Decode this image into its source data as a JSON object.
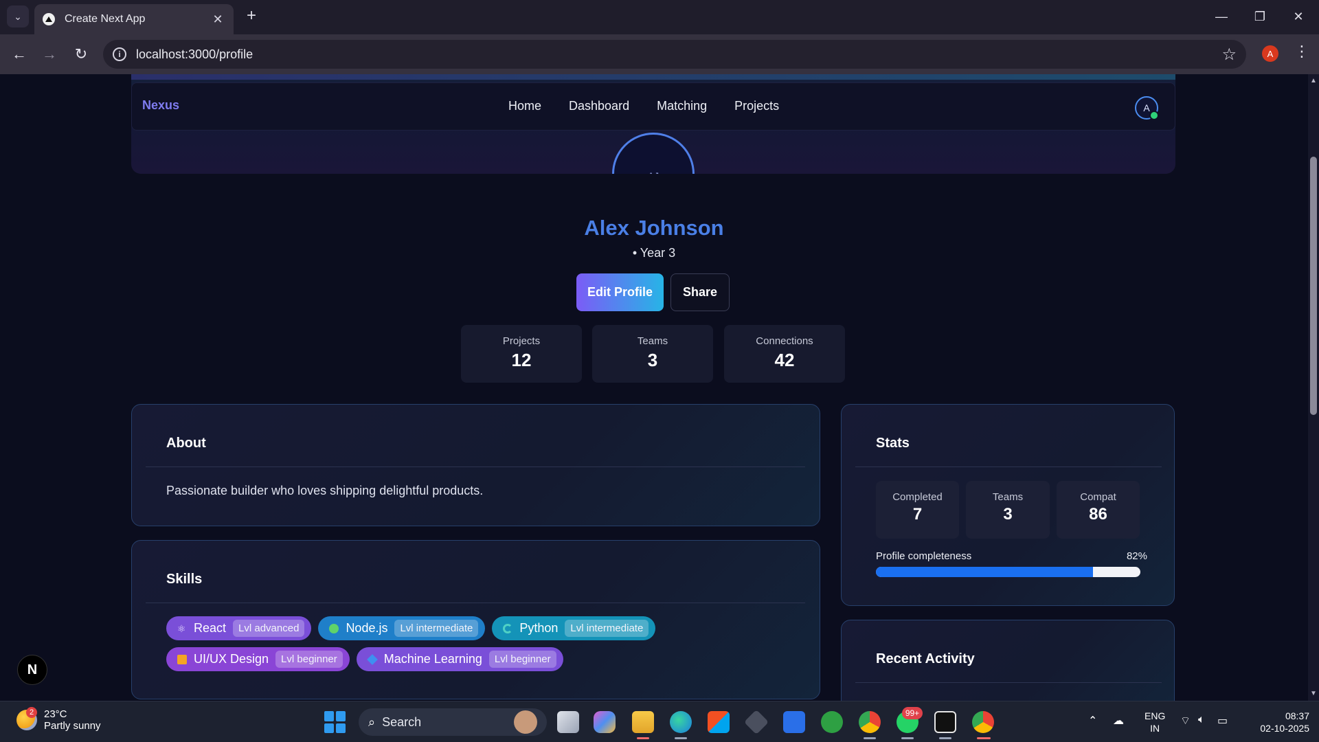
{
  "browser": {
    "tab_title": "Create Next App",
    "url": "localhost:3000/profile",
    "profile_initial": "A"
  },
  "nav": {
    "brand": "Nexus",
    "links": [
      "Home",
      "Dashboard",
      "Matching",
      "Projects"
    ],
    "avatar_initial": "A"
  },
  "profile": {
    "hero_initials": "AJ",
    "name": "Alex Johnson",
    "subtitle": "• Year 3",
    "edit_label": "Edit Profile",
    "share_label": "Share"
  },
  "summary_stats": [
    {
      "label": "Projects",
      "value": "12"
    },
    {
      "label": "Teams",
      "value": "3"
    },
    {
      "label": "Connections",
      "value": "42"
    }
  ],
  "about": {
    "title": "About",
    "text": "Passionate builder who loves shipping delightful products."
  },
  "skills": {
    "title": "Skills",
    "items": [
      {
        "name": "React",
        "level": "Lvl advanced",
        "color": "#7a4fd8",
        "icon": "atom-icon"
      },
      {
        "name": "Node.js",
        "level": "Lvl intermediate",
        "color": "#1f7fc9",
        "icon": "green-dot-icon"
      },
      {
        "name": "Python",
        "level": "Lvl intermediate",
        "color": "#1493b8",
        "icon": "python-icon"
      },
      {
        "name": "UI/UX Design",
        "level": "Lvl beginner",
        "color": "#8a45d6",
        "icon": "orange-square-icon"
      },
      {
        "name": "Machine Learning",
        "level": "Lvl beginner",
        "color": "#7a4fd8",
        "icon": "diamond-icon"
      }
    ]
  },
  "stats_panel": {
    "title": "Stats",
    "cards": [
      {
        "label": "Completed",
        "value": "7"
      },
      {
        "label": "Teams",
        "value": "3"
      },
      {
        "label": "Compat",
        "value": "86"
      }
    ],
    "progress_label": "Profile completeness",
    "progress_text": "82%",
    "progress_value": 0.82
  },
  "recent_activity": {
    "title": "Recent Activity"
  },
  "dev_badge": "N",
  "taskbar": {
    "weather_badge": "2",
    "temperature": "23°C",
    "weather_desc": "Partly sunny",
    "search_label": "Search",
    "whatsapp_badge": "99+",
    "lang_primary": "ENG",
    "lang_secondary": "IN",
    "time": "08:37",
    "date": "02-10-2025"
  },
  "colors": {
    "accent_blue": "#4a7fe6",
    "brand_purple": "#7f7cf0",
    "progress_fill": "#1a6ff0"
  }
}
